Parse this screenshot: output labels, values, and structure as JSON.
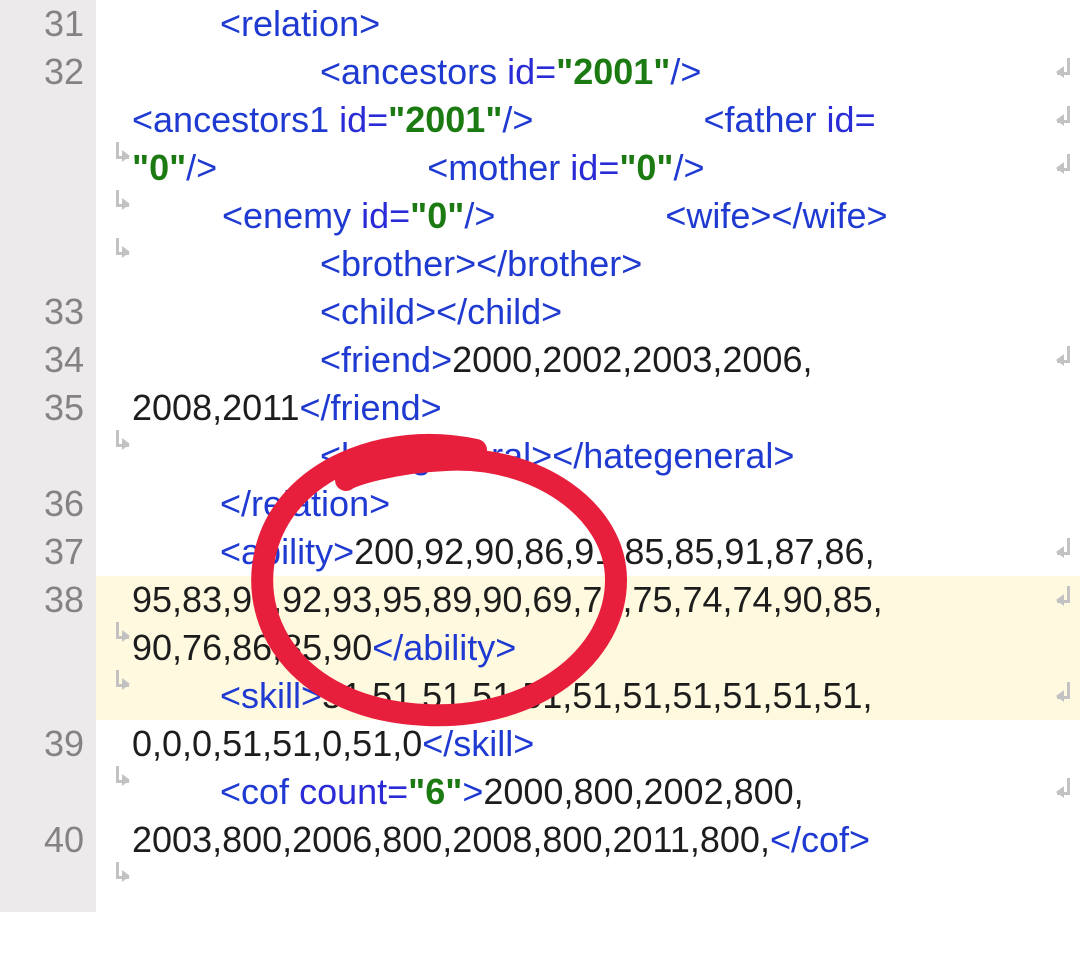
{
  "gutter": {
    "l31": "31",
    "l32": "32",
    "l33": "33",
    "l34": "34",
    "l35": "35",
    "l36": "36",
    "l37": "37",
    "l38": "38",
    "l39": "39",
    "l40": "40"
  },
  "code": {
    "l31": {
      "open_relation": "<relation>"
    },
    "l32": {
      "ancestors_open": "<ancestors ",
      "ancestors_attr": "id=",
      "ancestors_val": "\"2001\"",
      "ancestors_close": "/>",
      "ancestors1_open": "<ancestors1 ",
      "ancestors1_attr": "id=",
      "ancestors1_val": "\"2001\"",
      "ancestors1_close": "/>",
      "father_open": "<father ",
      "father_attr": "id=",
      "father_val": "\"0\"",
      "father_close": "/>",
      "mother_open": "<mother ",
      "mother_attr": "id=",
      "mother_val": "\"0\"",
      "mother_close": "/>",
      "enemy_open": "<enemy ",
      "enemy_attr": "id=",
      "enemy_val": "\"0\"",
      "enemy_close": "/>",
      "wife_open": "<wife>",
      "wife_close": "</wife>"
    },
    "l33": {
      "brother_open": "<brother>",
      "brother_close": "</brother>"
    },
    "l34": {
      "child_open": "<child>",
      "child_close": "</child>"
    },
    "l35": {
      "friend_open": "<friend>",
      "friend_text_a": "2000,2002,2003,2006,",
      "friend_text_b": "2008,2011",
      "friend_close": "</friend>"
    },
    "l36": {
      "hate_open": "<hategeneral>",
      "hate_close": "</hategeneral>"
    },
    "l37": {
      "relation_close": "</relation>"
    },
    "l38": {
      "ability_open": "<ability>",
      "ability_text_a": "200,92,90,86,91,85,85,91,87,86,",
      "ability_text_b": "95,83,90,92,93,95,89,90,69,76,75,74,74,90,85,",
      "ability_text_c": "90,76,86,85,90",
      "ability_close": "</ability>"
    },
    "l39": {
      "skill_open": "<skill>",
      "skill_text_a": "51,51,51,51,51,51,51,51,51,51,51,",
      "skill_text_b": "0,0,0,51,51,0,51,0",
      "skill_close": "</skill>"
    },
    "l40": {
      "cof_open": "<cof ",
      "cof_attr": "count=",
      "cof_val": "\"6\"",
      "cof_gt": ">",
      "cof_text_a": "2000,800,2002,800,",
      "cof_text_b": "2003,800,2006,800,2008,800,2011,800,",
      "cof_close": "</cof>"
    }
  }
}
